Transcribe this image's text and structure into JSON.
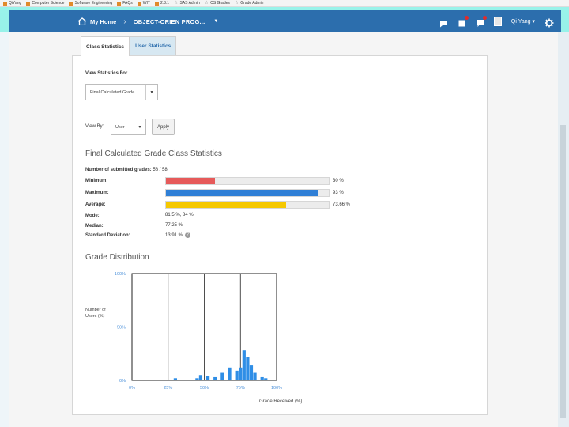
{
  "bookmarks": [
    {
      "label": "QiYang",
      "icon": "page-icon"
    },
    {
      "label": "Computer Science",
      "icon": "page-icon"
    },
    {
      "label": "Software Engineering",
      "icon": "page-icon"
    },
    {
      "label": "FAQs",
      "icon": "page-icon"
    },
    {
      "label": "WIT",
      "icon": "page-icon"
    },
    {
      "label": "2.3.1",
      "icon": "page-icon"
    },
    {
      "label": "SAS Admin",
      "icon": "star-icon"
    },
    {
      "label": "CS Grades",
      "icon": "star-icon"
    },
    {
      "label": "Grade Admin",
      "icon": "star-icon"
    }
  ],
  "nav": {
    "home": "My Home",
    "course": "OBJECT-ORIEN PROG...",
    "user": "Qi Yang"
  },
  "tabs": [
    "Class Statistics",
    "User Statistics"
  ],
  "form": {
    "view_stats_label": "View Statistics For",
    "view_stats_value": "Final Calculated Grade",
    "view_by_label": "View By:",
    "view_by_value": "User",
    "apply": "Apply"
  },
  "stats": {
    "title": "Final Calculated Grade Class Statistics",
    "submitted_label": "Number of submitted grades:",
    "submitted_value": "58 / 58",
    "minimum_label": "Minimum:",
    "minimum_pct": "30 %",
    "minimum_frac": 0.3,
    "maximum_label": "Maximum:",
    "maximum_pct": "93 %",
    "maximum_frac": 0.93,
    "average_label": "Average:",
    "average_pct": "73.66 %",
    "average_frac": 0.7366,
    "mode_label": "Mode:",
    "mode_value": "81.5 %, 84 %",
    "median_label": "Median:",
    "median_value": "77.25 %",
    "sd_label": "Standard Deviation:",
    "sd_value": "13.91 %"
  },
  "colors": {
    "minimum": "#e65a5a",
    "maximum": "#2f7fd6",
    "average": "#f5c800",
    "histogram": "#2f8ee6",
    "nav": "#2c6ead"
  },
  "distribution": {
    "title": "Grade Distribution",
    "ylabel": "Number of Users (%)",
    "xlabel": "Grade Received (%)"
  },
  "chart_data": {
    "type": "bar",
    "title": "Grade Distribution",
    "xlabel": "Grade Received (%)",
    "ylabel": "Number of Users (%)",
    "x_ticks": [
      "0%",
      "25%",
      "50%",
      "75%",
      "100%"
    ],
    "y_ticks": [
      "0%",
      "50%",
      "100%"
    ],
    "xlim": [
      0,
      100
    ],
    "ylim": [
      0,
      100
    ],
    "grid": true,
    "bins": [
      {
        "x": 30,
        "value": 2
      },
      {
        "x": 45,
        "value": 2
      },
      {
        "x": 47.5,
        "value": 5
      },
      {
        "x": 52.5,
        "value": 4
      },
      {
        "x": 57.5,
        "value": 3
      },
      {
        "x": 62.5,
        "value": 7
      },
      {
        "x": 67.5,
        "value": 12
      },
      {
        "x": 72.5,
        "value": 9
      },
      {
        "x": 75,
        "value": 12
      },
      {
        "x": 77.5,
        "value": 28
      },
      {
        "x": 80,
        "value": 22
      },
      {
        "x": 82.5,
        "value": 14
      },
      {
        "x": 85,
        "value": 7
      },
      {
        "x": 90,
        "value": 3
      },
      {
        "x": 92.5,
        "value": 2
      }
    ]
  }
}
